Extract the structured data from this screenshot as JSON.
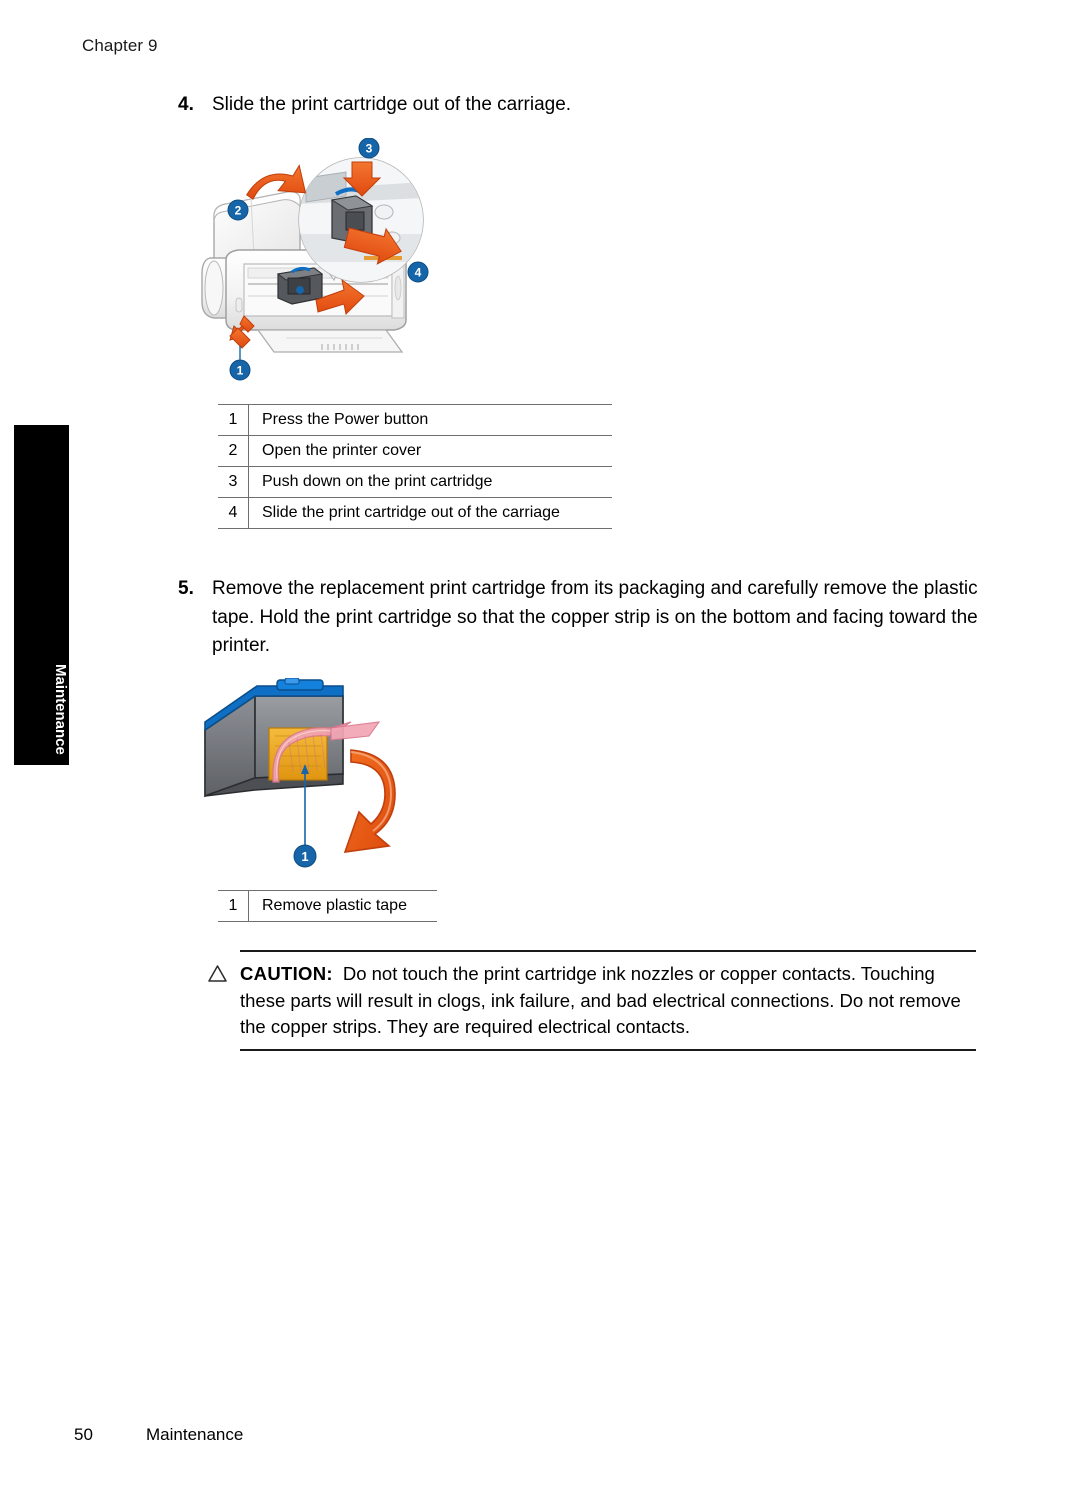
{
  "header": {
    "chapter": "Chapter 9"
  },
  "edge_tab": {
    "label": "Maintenance"
  },
  "steps": [
    {
      "number": "4.",
      "text": "Slide the print cartridge out of the carriage."
    },
    {
      "number": "5.",
      "text": "Remove the replacement print cartridge from its packaging and carefully remove the plastic tape. Hold the print cartridge so that the copper strip is on the bottom and facing toward the printer."
    }
  ],
  "figure_printer": {
    "alt": "Printer with cover open showing print cartridge carriage and magnified inset",
    "callouts": [
      "1",
      "2",
      "3",
      "4"
    ],
    "colors": {
      "callout_blue": "#1565a8",
      "arrow_orange": "#e8521d",
      "body_light": "#f4f4f4",
      "outline": "#9a9a9a"
    }
  },
  "figure_cartridge": {
    "alt": "Print cartridge with plastic tape being removed",
    "callouts": [
      "1"
    ],
    "colors": {
      "cartridge_body": "#6e6e6e",
      "cartridge_top": "#0f6fc4",
      "copper": "#f0a818",
      "tape_pink": "#f0a3b2",
      "arrow_orange": "#e8521d",
      "callout_blue": "#1565a8"
    }
  },
  "legend_printer": {
    "rows": [
      {
        "num": "1",
        "desc": "Press the Power button"
      },
      {
        "num": "2",
        "desc": "Open the printer cover"
      },
      {
        "num": "3",
        "desc": "Push down on the print cartridge"
      },
      {
        "num": "4",
        "desc": "Slide the print cartridge out of the carriage"
      }
    ]
  },
  "legend_cartridge": {
    "rows": [
      {
        "num": "1",
        "desc": "Remove plastic tape"
      }
    ]
  },
  "caution": {
    "icon": "warning-triangle-icon",
    "label": "CAUTION:",
    "text": "Do not touch the print cartridge ink nozzles or copper contacts. Touching these parts will result in clogs, ink failure, and bad electrical connections. Do not remove the copper strips. They are required electrical contacts."
  },
  "footer": {
    "page_number": "50",
    "section": "Maintenance"
  }
}
